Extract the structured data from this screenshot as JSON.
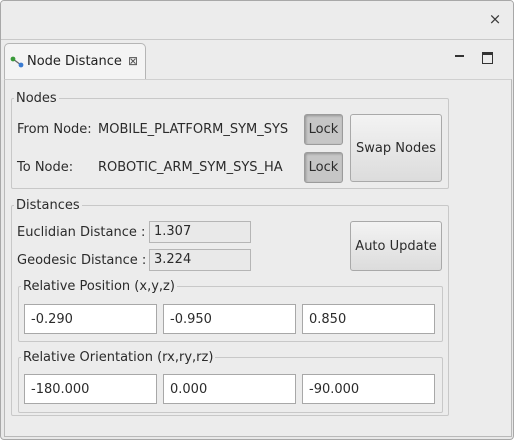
{
  "window": {
    "close_label": "×"
  },
  "tab": {
    "title": "Node Distance",
    "close_glyph": "⊠"
  },
  "nodes": {
    "legend": "Nodes",
    "from_label": "From Node:",
    "from_value": "MOBILE_PLATFORM_SYM_SYS",
    "to_label": "To Node:",
    "to_value": "ROBOTIC_ARM_SYM_SYS_HA",
    "lock_label": "Lock",
    "swap_label": "Swap Nodes"
  },
  "distances": {
    "legend": "Distances",
    "euclidian_label": "Euclidian Distance :",
    "euclidian_value": "1.307",
    "geodesic_label": "Geodesic Distance :",
    "geodesic_value": "3.224",
    "auto_update_label": "Auto Update",
    "position": {
      "legend": "Relative Position (x,y,z)",
      "x": "-0.290",
      "y": "-0.950",
      "z": "0.850"
    },
    "orientation": {
      "legend": "Relative Orientation (rx,ry,rz)",
      "rx": "-180.000",
      "ry": "0.000",
      "rz": "-90.000"
    }
  },
  "icons": {
    "tab": "node-distance-icon",
    "close": "close-icon",
    "minimize": "minimize-icon",
    "maximize": "maximize-icon"
  },
  "colors": {
    "panel_bg": "#ececec",
    "window_bg": "#e8e8e8",
    "icon_green": "#3a9a3a",
    "icon_blue": "#3b7bd1"
  }
}
